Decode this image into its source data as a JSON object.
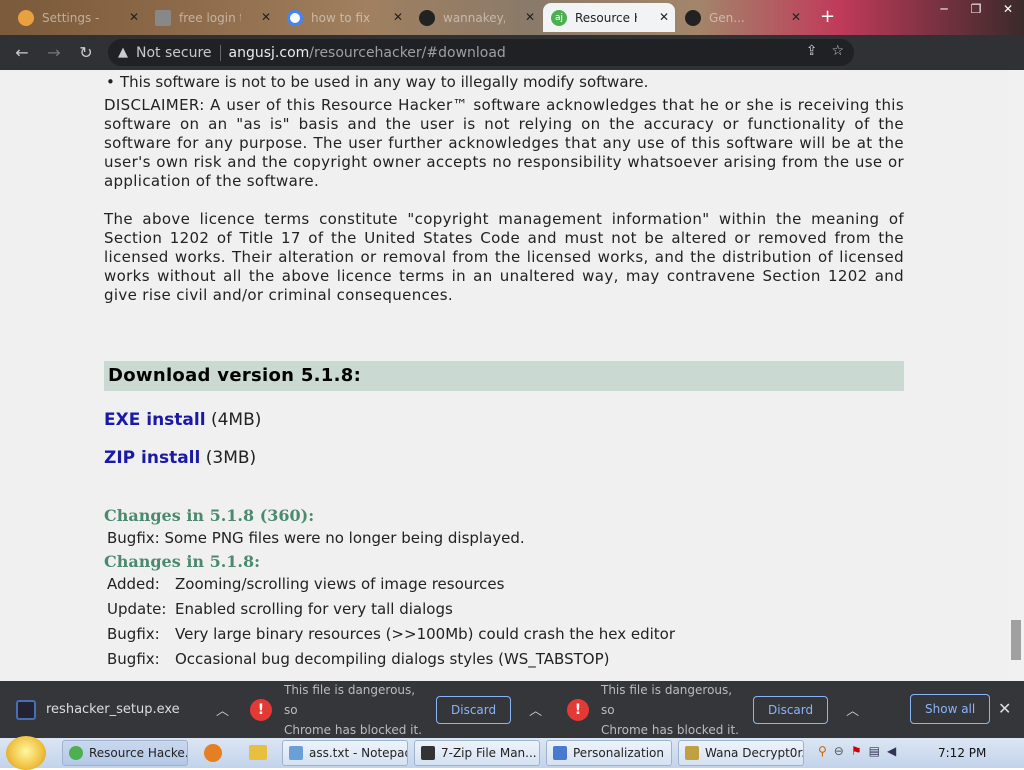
{
  "tabs": [
    {
      "label": "Settings - S...",
      "icon": "gear-icon",
      "color": "#e8a040"
    },
    {
      "label": "free login t...",
      "icon": "page-icon",
      "color": "#999999"
    },
    {
      "label": "how to fix ...",
      "icon": "google-icon",
      "color": "#4285f4"
    },
    {
      "label": "wannakey/...",
      "icon": "github-icon",
      "color": "#222222"
    },
    {
      "label": "Resource Ha...",
      "icon": "aj-icon",
      "color": "#4caf50",
      "active": true
    },
    {
      "label": "Gen...",
      "icon": "github-icon",
      "color": "#222222"
    }
  ],
  "address": {
    "security": "Not secure",
    "domain": "angusj.com",
    "path": "/resourcehacker/#download"
  },
  "content": {
    "bullet": "This software is not to be used in any way to illegally modify software.",
    "disclaimer": "DISCLAIMER: A user of this Resource Hacker™ software acknowledges that he or she is receiving this software on an \"as is\" basis and the user is not relying on the accuracy or functionality of the software for any purpose. The user further acknowledges that any use of this software will be at the user's own risk and the copyright owner accepts no responsibility whatsoever arising from the use or application of the software.",
    "licence": "The above licence terms constitute \"copyright management information\" within the meaning of Section 1202 of Title 17 of the United States Code and must not be altered or removed from the licensed works. Their alteration or removal from the licensed works, and the distribution of licensed works without all the above licence terms in an unaltered way, may contravene Section 1202 and give rise civil and/or criminal consequences.",
    "download_heading": "Download version 5.1.8:",
    "exe_link": "EXE install",
    "exe_size": "(4MB)",
    "zip_link": "ZIP install",
    "zip_size": "(3MB)",
    "changes1_title": "Changes in 5.1.8 (360):",
    "changes1": [
      {
        "kind": "Bugfix:",
        "text": "Some PNG files were no longer being displayed."
      }
    ],
    "changes2_title": "Changes in 5.1.8:",
    "changes2": [
      {
        "kind": "Added:",
        "text": "Zooming/scrolling views of image resources"
      },
      {
        "kind": "Update:",
        "text": "Enabled scrolling for very tall dialogs"
      },
      {
        "kind": "Bugfix:",
        "text": "Very large binary resources (>>100Mb) could crash the hex editor"
      },
      {
        "kind": "Bugfix:",
        "text": "Occasional bug decompiling dialogs styles (WS_TABSTOP)"
      }
    ]
  },
  "downloads": {
    "file": "reshacker_setup.exe",
    "danger_line1": "This file is dangerous, so",
    "danger_line2": "Chrome has blocked it.",
    "discard": "Discard",
    "show_all": "Show all"
  },
  "taskbar": {
    "items": [
      {
        "label": "Resource Hacke...",
        "color": "#4caf50"
      },
      {
        "label": "ass.txt - Notepad",
        "color": "#6a9fd8"
      },
      {
        "label": "7-Zip File Man...",
        "color": "#333333"
      },
      {
        "label": "Personalization",
        "color": "#4a7ad0"
      },
      {
        "label": "Wana Decrypt0r...",
        "color": "#c0a040"
      }
    ],
    "clock": "7:12 PM"
  }
}
